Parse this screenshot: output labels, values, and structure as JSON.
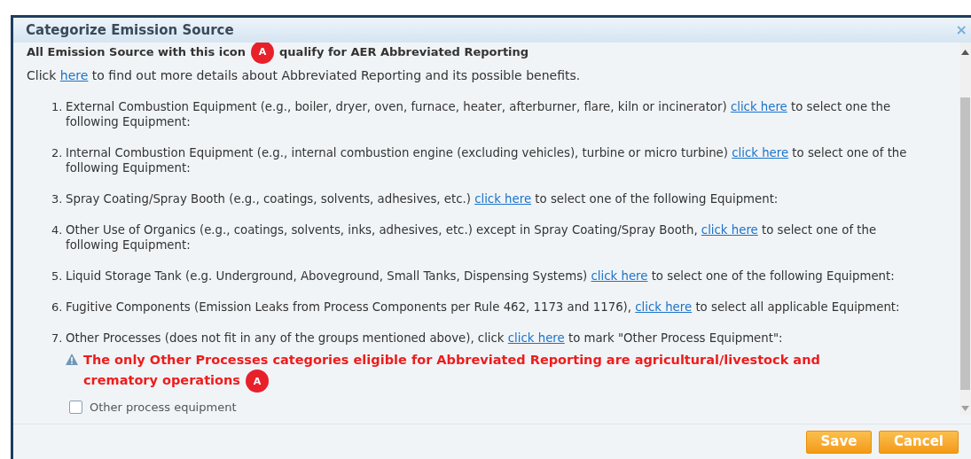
{
  "dialog": {
    "title": "Categorize Emission Source",
    "close": "×"
  },
  "intro": {
    "before": "All Emission Source with this icon",
    "badge": "A",
    "after": "qualify for AER Abbreviated Reporting"
  },
  "info": {
    "before": "Click ",
    "link": "here",
    "after": " to find out more details about Abbreviated Reporting and its possible benefits."
  },
  "items": [
    {
      "number": "1.",
      "before": "External Combustion Equipment (e.g., boiler, dryer, oven, furnace, heater, afterburner, flare, kiln or incinerator) ",
      "link": "click here",
      "after": " to select one the following Equipment:"
    },
    {
      "number": "2.",
      "before": "Internal Combustion Equipment (e.g., internal combustion engine (excluding vehicles), turbine or micro turbine) ",
      "link": "click here",
      "after": " to select one of the following Equipment:"
    },
    {
      "number": "3.",
      "before": "Spray Coating/Spray Booth (e.g., coatings, solvents, adhesives, etc.) ",
      "link": "click here",
      "after": " to select one of the following Equipment:"
    },
    {
      "number": "4.",
      "before": "Other Use of Organics (e.g., coatings, solvents, inks, adhesives, etc.) except in Spray Coating/Spray Booth, ",
      "link": "click here",
      "after": " to select one of the following Equipment:"
    },
    {
      "number": "5.",
      "before": "Liquid Storage Tank (e.g. Underground, Aboveground, Small Tanks, Dispensing Systems) ",
      "link": "click here",
      "after": " to select one of the following Equipment:"
    },
    {
      "number": "6.",
      "before": "Fugitive Components (Emission Leaks from Process Components per Rule 462, 1173 and 1176), ",
      "link": "click here",
      "after": " to select all applicable Equipment:"
    },
    {
      "number": "7.",
      "before": "Other Processes (does not fit in any of the groups mentioned above), click ",
      "link": "click here",
      "after": " to mark \"Other Process Equipment\":",
      "warning": {
        "text": "The only Other Processes categories eligible for Abbreviated Reporting are agricultural/livestock and crematory operations",
        "badge": "A"
      },
      "checkbox": {
        "label": "Other process equipment",
        "checked": false
      }
    }
  ],
  "buttons": [
    "Save",
    "Cancel"
  ]
}
